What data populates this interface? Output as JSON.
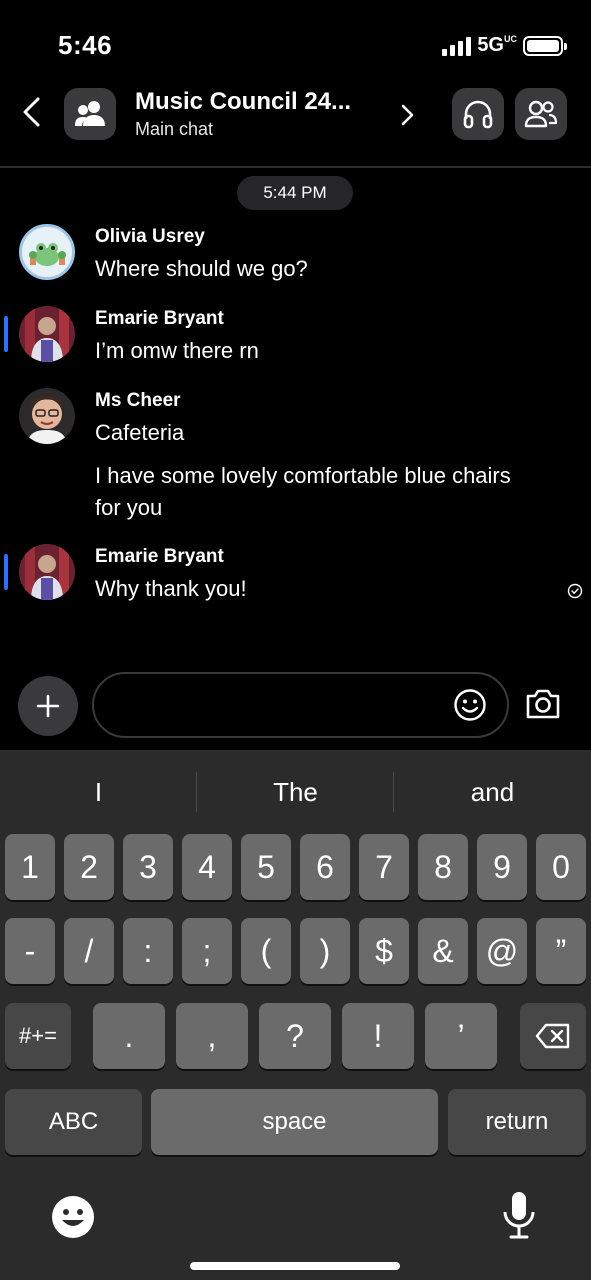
{
  "status_bar": {
    "time": "5:46",
    "network": "5G",
    "network_sup": "UC"
  },
  "header": {
    "title": "Music Council 24...",
    "subtitle": "Main chat"
  },
  "chat": {
    "timestamp": "5:44 PM",
    "messages": [
      {
        "sender": "Olivia Usrey",
        "lines": [
          "Where should we go?"
        ]
      },
      {
        "sender": "Emarie Bryant",
        "lines": [
          "I’m omw there rn"
        ]
      },
      {
        "sender": "Ms Cheer",
        "lines": [
          "Cafeteria",
          "I have some lovely comfortable blue chairs for you"
        ]
      },
      {
        "sender": "Emarie Bryant",
        "lines": [
          "Why thank you!"
        ]
      }
    ]
  },
  "composer": {
    "placeholder": ""
  },
  "keyboard": {
    "suggestions": [
      "I",
      "The",
      "and"
    ],
    "row1": [
      "1",
      "2",
      "3",
      "4",
      "5",
      "6",
      "7",
      "8",
      "9",
      "0"
    ],
    "row2": [
      "-",
      "/",
      ":",
      ";",
      "(",
      ")",
      "$",
      "&",
      "@",
      "”"
    ],
    "row3_toggle": "#+=",
    "row3": [
      ".",
      ",",
      "?",
      "!",
      "’"
    ],
    "abc": "ABC",
    "space": "space",
    "return": "return"
  },
  "colors": {
    "accent": "#2f6fff",
    "background": "#000000",
    "key": "#6b6b6b",
    "key_dark": "#474747"
  }
}
